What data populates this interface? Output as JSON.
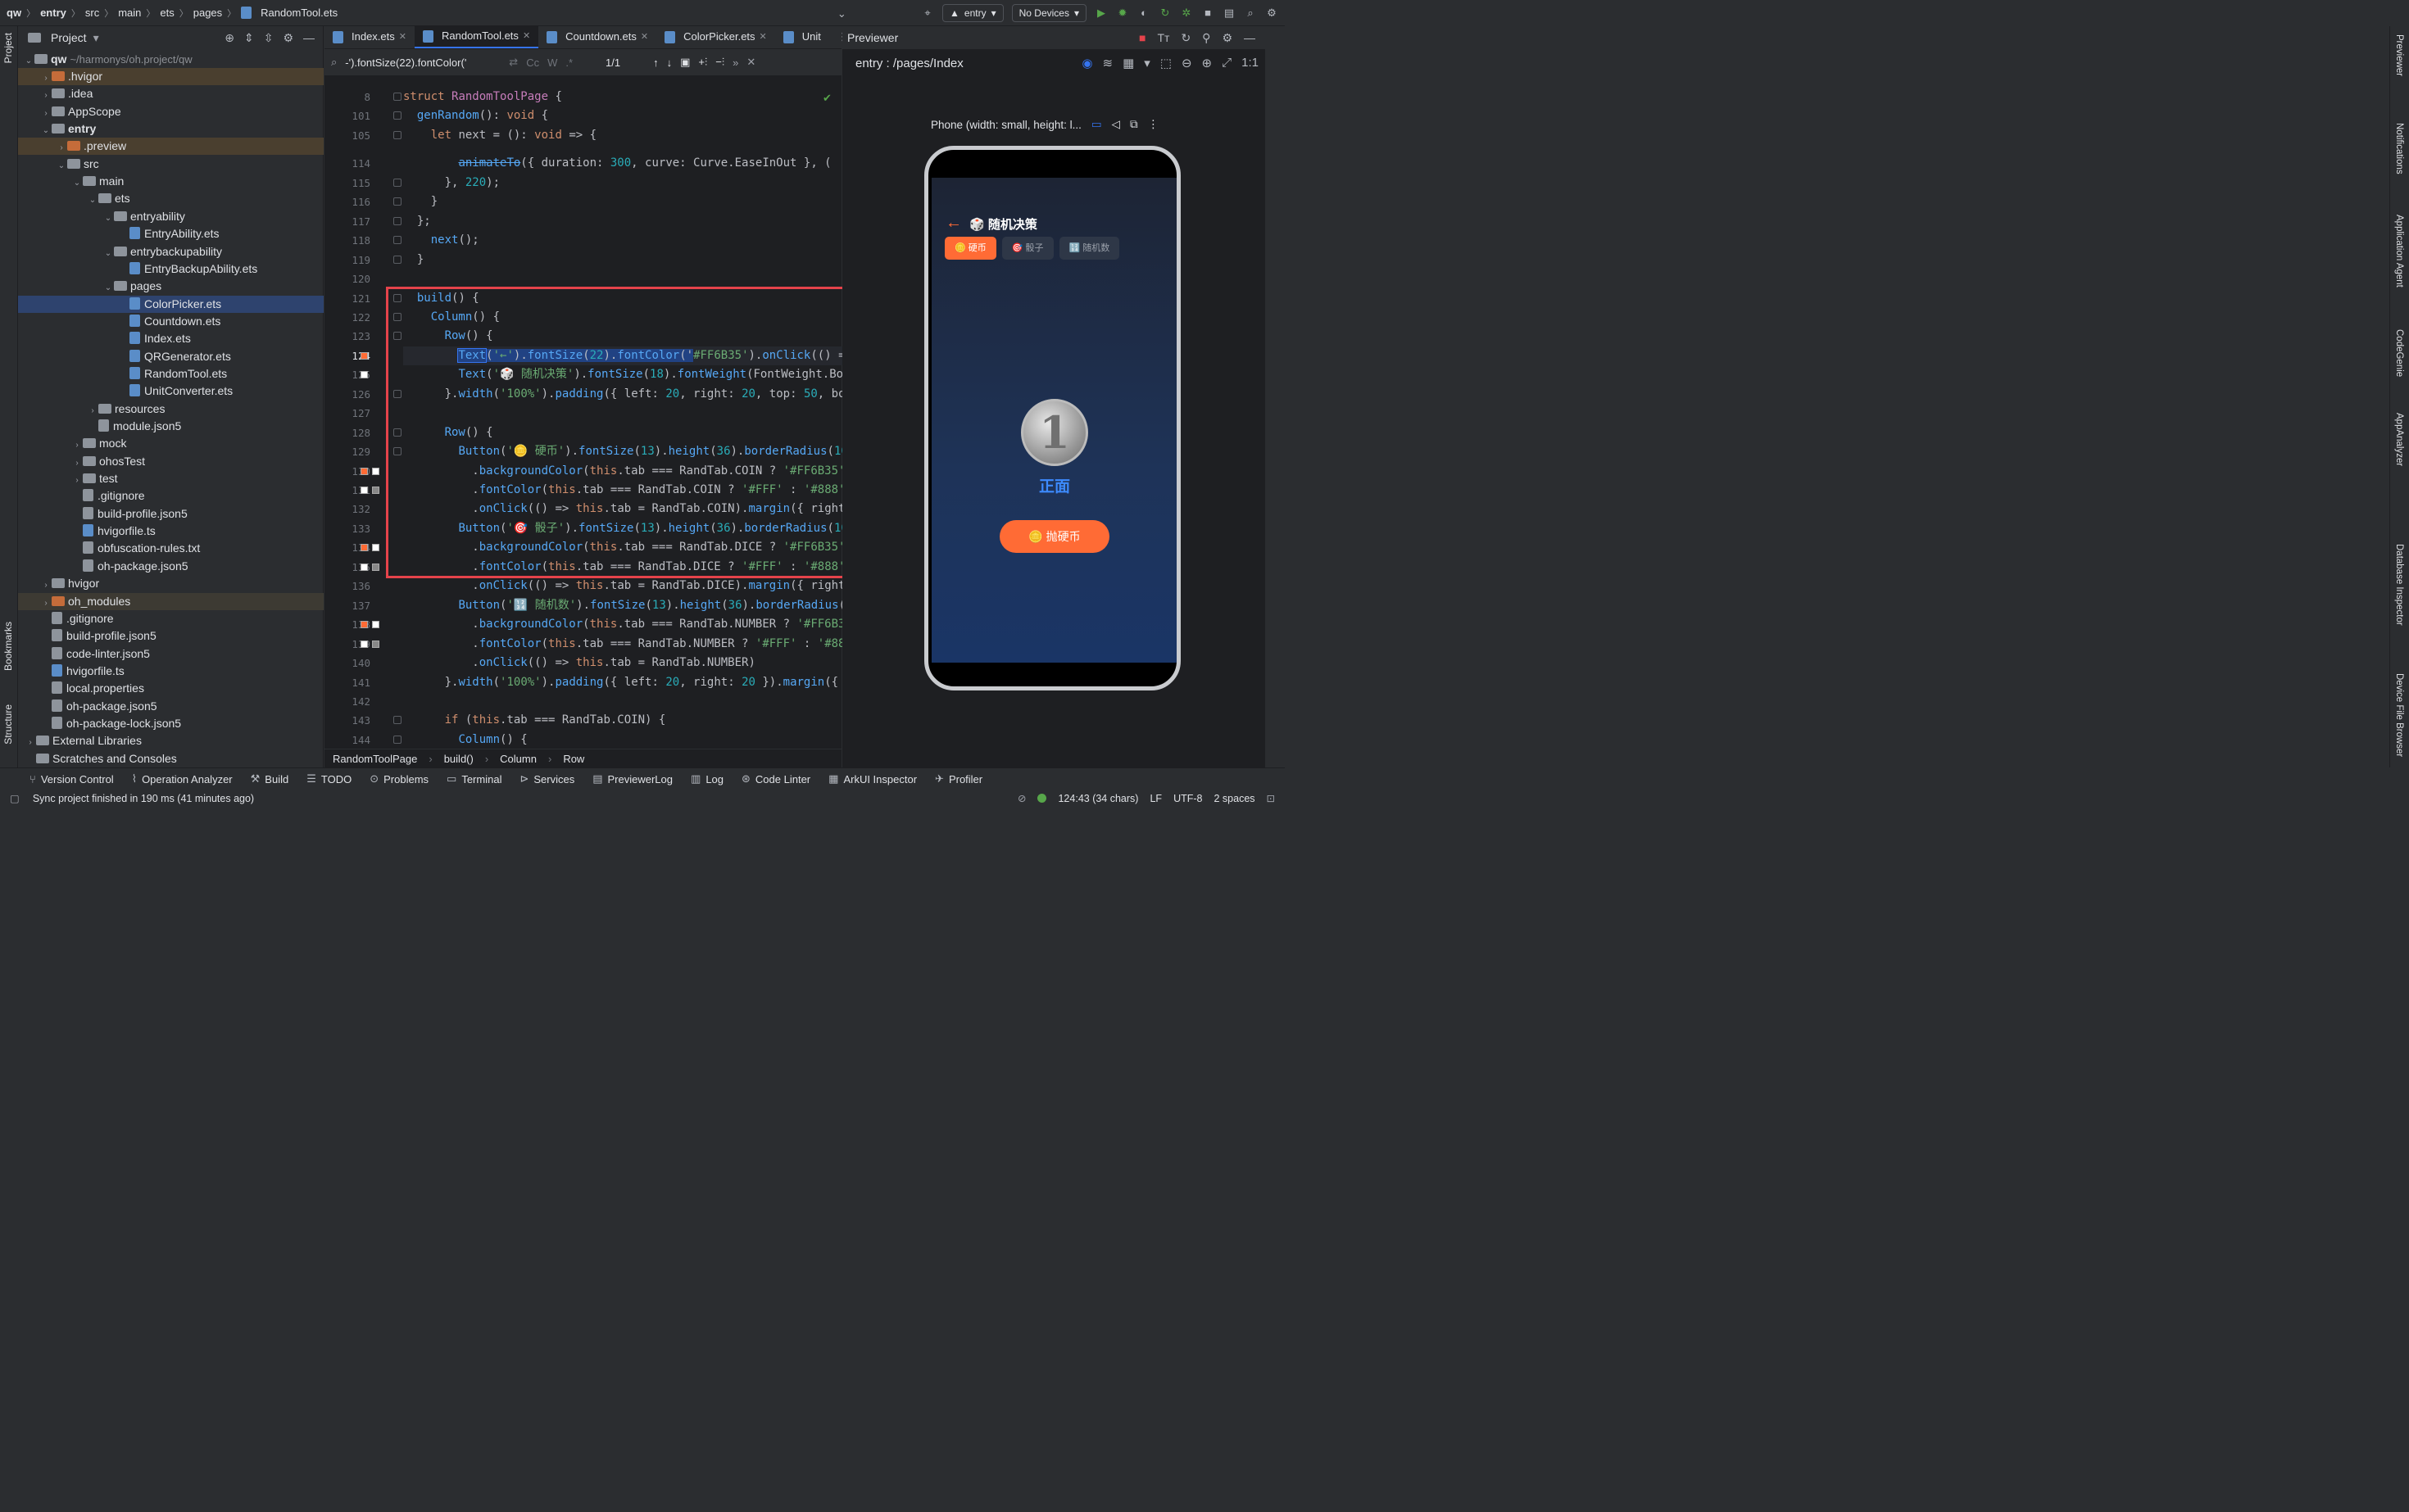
{
  "breadcrumb": [
    "qw",
    "entry",
    "src",
    "main",
    "ets",
    "pages",
    "RandomTool.ets"
  ],
  "toolbar": {
    "run_config": "entry",
    "device": "No Devices"
  },
  "left_strip": {
    "project": "Project",
    "bookmarks": "Bookmarks",
    "structure": "Structure"
  },
  "right_strip": {
    "previewer": "Previewer",
    "notifications": "Notifications",
    "agent": "Application Agent",
    "codegenie": "CodeGenie",
    "appanalyzer": "AppAnalyzer",
    "db": "Database Inspector",
    "dfb": "Device File Browser"
  },
  "project": {
    "title": "Project",
    "root_name": "qw",
    "root_path": "~/harmonys/oh.project/qw",
    "rows": [
      {
        "label": ".hvigor",
        "indent": 1,
        "arrow": "›",
        "icon": "folder-orange",
        "style": "hl"
      },
      {
        "label": ".idea",
        "indent": 1,
        "arrow": "›",
        "icon": "folder"
      },
      {
        "label": "AppScope",
        "indent": 1,
        "arrow": "›",
        "icon": "folder"
      },
      {
        "label": "entry",
        "indent": 1,
        "arrow": "⌄",
        "icon": "folder",
        "bold": true
      },
      {
        "label": ".preview",
        "indent": 2,
        "arrow": "›",
        "icon": "folder-orange",
        "style": "hl"
      },
      {
        "label": "src",
        "indent": 2,
        "arrow": "⌄",
        "icon": "folder"
      },
      {
        "label": "main",
        "indent": 3,
        "arrow": "⌄",
        "icon": "folder"
      },
      {
        "label": "ets",
        "indent": 4,
        "arrow": "⌄",
        "icon": "folder"
      },
      {
        "label": "entryability",
        "indent": 5,
        "arrow": "⌄",
        "icon": "folder"
      },
      {
        "label": "EntryAbility.ets",
        "indent": 6,
        "icon": "file"
      },
      {
        "label": "entrybackupability",
        "indent": 5,
        "arrow": "⌄",
        "icon": "folder"
      },
      {
        "label": "EntryBackupAbility.ets",
        "indent": 6,
        "icon": "file"
      },
      {
        "label": "pages",
        "indent": 5,
        "arrow": "⌄",
        "icon": "folder"
      },
      {
        "label": "ColorPicker.ets",
        "indent": 6,
        "icon": "file",
        "style": "sel"
      },
      {
        "label": "Countdown.ets",
        "indent": 6,
        "icon": "file"
      },
      {
        "label": "Index.ets",
        "indent": 6,
        "icon": "file"
      },
      {
        "label": "QRGenerator.ets",
        "indent": 6,
        "icon": "file"
      },
      {
        "label": "RandomTool.ets",
        "indent": 6,
        "icon": "file"
      },
      {
        "label": "UnitConverter.ets",
        "indent": 6,
        "icon": "file"
      },
      {
        "label": "resources",
        "indent": 4,
        "arrow": "›",
        "icon": "folder"
      },
      {
        "label": "module.json5",
        "indent": 4,
        "icon": "file-gray"
      },
      {
        "label": "mock",
        "indent": 3,
        "arrow": "›",
        "icon": "folder"
      },
      {
        "label": "ohosTest",
        "indent": 3,
        "arrow": "›",
        "icon": "folder"
      },
      {
        "label": "test",
        "indent": 3,
        "arrow": "›",
        "icon": "folder"
      },
      {
        "label": ".gitignore",
        "indent": 3,
        "icon": "file-gray"
      },
      {
        "label": "build-profile.json5",
        "indent": 3,
        "icon": "file-gray"
      },
      {
        "label": "hvigorfile.ts",
        "indent": 3,
        "icon": "file"
      },
      {
        "label": "obfuscation-rules.txt",
        "indent": 3,
        "icon": "file-gray"
      },
      {
        "label": "oh-package.json5",
        "indent": 3,
        "icon": "file-gray"
      },
      {
        "label": "hvigor",
        "indent": 1,
        "arrow": "›",
        "icon": "folder"
      },
      {
        "label": "oh_modules",
        "indent": 1,
        "arrow": "›",
        "icon": "folder-orange",
        "style": "hl2"
      },
      {
        "label": ".gitignore",
        "indent": 1,
        "icon": "file-gray"
      },
      {
        "label": "build-profile.json5",
        "indent": 1,
        "icon": "file-gray"
      },
      {
        "label": "code-linter.json5",
        "indent": 1,
        "icon": "file-gray"
      },
      {
        "label": "hvigorfile.ts",
        "indent": 1,
        "icon": "file"
      },
      {
        "label": "local.properties",
        "indent": 1,
        "icon": "file-gray"
      },
      {
        "label": "oh-package.json5",
        "indent": 1,
        "icon": "file-gray"
      },
      {
        "label": "oh-package-lock.json5",
        "indent": 1,
        "icon": "file-gray"
      },
      {
        "label": "External Libraries",
        "indent": 0,
        "arrow": "›",
        "icon": "lib"
      },
      {
        "label": "Scratches and Consoles",
        "indent": 0,
        "icon": "scratch"
      }
    ]
  },
  "editor": {
    "tabs": [
      "Index.ets",
      "RandomTool.ets",
      "Countdown.ets",
      "ColorPicker.ets",
      "Unit"
    ],
    "active_tab": 1,
    "search_text": "-').fontSize(22).fontColor('",
    "match_count": "1/1",
    "lines": [
      {
        "n": "8",
        "html": "<span class='kw'>struct</span> <span class='ty'>RandomToolPage</span> {"
      },
      {
        "n": "101",
        "html": "  <span class='fn'>genRandom</span>(): <span class='kw'>void</span> {"
      },
      {
        "n": "105",
        "html": "    <span class='kw'>let</span> next = (): <span class='kw'>void</span> => {"
      },
      {
        "n": "114",
        "html": "        <span class='fn' style='text-decoration:line-through'>animateTo</span>({ duration: <span class='num'>300</span>, curve: Curve.EaseInOut }, ("
      },
      {
        "n": "115",
        "html": "      }, <span class='num'>220</span>);"
      },
      {
        "n": "116",
        "html": "    }"
      },
      {
        "n": "117",
        "html": "  };"
      },
      {
        "n": "118",
        "html": "    <span class='fn'>next</span>();"
      },
      {
        "n": "119",
        "html": "  }"
      },
      {
        "n": "120",
        "html": ""
      },
      {
        "n": "121",
        "html": "  <span class='fn'>build</span>() {"
      },
      {
        "n": "122",
        "html": "    <span class='fn'>Column</span>() {"
      },
      {
        "n": "123",
        "html": "      <span class='fn'>Row</span>() {"
      },
      {
        "n": "124",
        "html": "        <span class='fn' style='background:#214283;outline:1px solid #3574f0'>Text</span><span style='background:#214283'>(<span class='str'>'←'</span>).<span class='fn'>fontSize</span>(<span class='num'>22</span>).<span class='fn'>fontColor</span>('</span><span class='str'>#FF6B35'</span>).<span class='fn'>onClick</span>(() ="
      },
      {
        "n": "125",
        "html": "        <span class='fn'>Text</span>(<span class='str'>'🎲 随机决策'</span>).<span class='fn'>fontSize</span>(<span class='num'>18</span>).<span class='fn'>fontWeight</span>(FontWeight.Bo"
      },
      {
        "n": "126",
        "html": "      }.<span class='fn'>width</span>(<span class='str'>'100%'</span>).<span class='fn'>padding</span>({ left: <span class='num'>20</span>, right: <span class='num'>20</span>, top: <span class='num'>50</span>, bo"
      },
      {
        "n": "127",
        "html": ""
      },
      {
        "n": "128",
        "html": "      <span class='fn'>Row</span>() {"
      },
      {
        "n": "129",
        "html": "        <span class='fn'>Button</span>(<span class='str'>'🪙 硬币'</span>).<span class='fn'>fontSize</span>(<span class='num'>13</span>).<span class='fn'>height</span>(<span class='num'>36</span>).<span class='fn'>borderRadius</span>(<span class='num'>10</span>"
      },
      {
        "n": "130",
        "html": "          .<span class='fn'>backgroundColor</span>(<span class='kw'>this</span>.tab === RandTab.COIN ? <span class='str'>'#FF6B35'</span>"
      },
      {
        "n": "131",
        "html": "          .<span class='fn'>fontColor</span>(<span class='kw'>this</span>.tab === RandTab.COIN ? <span class='str'>'#FFF'</span> : <span class='str'>'#888'</span>"
      },
      {
        "n": "132",
        "html": "          .<span class='fn'>onClick</span>(() => <span class='kw'>this</span>.tab = RandTab.COIN).<span class='fn'>margin</span>({ right"
      },
      {
        "n": "133",
        "html": "        <span class='fn'>Button</span>(<span class='str'>'🎯 骰子'</span>).<span class='fn'>fontSize</span>(<span class='num'>13</span>).<span class='fn'>height</span>(<span class='num'>36</span>).<span class='fn'>borderRadius</span>(<span class='num'>10</span>"
      },
      {
        "n": "134",
        "html": "          .<span class='fn'>backgroundColor</span>(<span class='kw'>this</span>.tab === RandTab.DICE ? <span class='str'>'#FF6B35'</span>"
      },
      {
        "n": "135",
        "html": "          .<span class='fn'>fontColor</span>(<span class='kw'>this</span>.tab === RandTab.DICE ? <span class='str'>'#FFF'</span> : <span class='str'>'#888'</span>"
      },
      {
        "n": "136",
        "html": "          .<span class='fn'>onClick</span>(() => <span class='kw'>this</span>.tab = RandTab.DICE).<span class='fn'>margin</span>({ right"
      },
      {
        "n": "137",
        "html": "        <span class='fn'>Button</span>(<span class='str'>'🔢 随机数'</span>).<span class='fn'>fontSize</span>(<span class='num'>13</span>).<span class='fn'>height</span>(<span class='num'>36</span>).<span class='fn'>borderRadius</span>("
      },
      {
        "n": "138",
        "html": "          .<span class='fn'>backgroundColor</span>(<span class='kw'>this</span>.tab === RandTab.NUMBER ? <span class='str'>'#FF6B3</span>"
      },
      {
        "n": "139",
        "html": "          .<span class='fn'>fontColor</span>(<span class='kw'>this</span>.tab === RandTab.NUMBER ? <span class='str'>'#FFF'</span> : <span class='str'>'#88</span>"
      },
      {
        "n": "140",
        "html": "          .<span class='fn'>onClick</span>(() => <span class='kw'>this</span>.tab = RandTab.NUMBER)"
      },
      {
        "n": "141",
        "html": "      }.<span class='fn'>width</span>(<span class='str'>'100%'</span>).<span class='fn'>padding</span>({ left: <span class='num'>20</span>, right: <span class='num'>20</span> }).<span class='fn'>margin</span>({"
      },
      {
        "n": "142",
        "html": ""
      },
      {
        "n": "143",
        "html": "      <span class='kw'>if</span> (<span class='kw'>this</span>.tab === RandTab.COIN) {"
      },
      {
        "n": "144",
        "html": "        <span class='fn'>Column</span>() {"
      }
    ],
    "swatches": [
      {
        "line": "124",
        "colors": [
          "#FF6B35"
        ]
      },
      {
        "line": "125",
        "colors": [
          "#FFFFFF"
        ]
      },
      {
        "line": "130",
        "colors": [
          "#FF6B35",
          "#FFFFFF"
        ]
      },
      {
        "line": "131",
        "colors": [
          "#FFFFFF",
          "#888888"
        ]
      },
      {
        "line": "134",
        "colors": [
          "#FF6B35",
          "#FFFFFF"
        ]
      },
      {
        "line": "135",
        "colors": [
          "#FFFFFF",
          "#888888"
        ]
      },
      {
        "line": "138",
        "colors": [
          "#FF6B35",
          "#FFFFFF"
        ]
      },
      {
        "line": "139",
        "colors": [
          "#FFFFFF",
          "#888888"
        ]
      }
    ],
    "breadcrumb": [
      "RandomToolPage",
      "build()",
      "Column",
      "Row"
    ]
  },
  "previewer": {
    "title": "Previewer",
    "route": "entry : /pages/Index",
    "device_label": "Phone (width: small, height: l...",
    "app": {
      "back": "←",
      "title": "🎲 随机决策",
      "tabs": [
        "🪙 硬币",
        "🎯 骰子",
        "🔢 随机数"
      ],
      "active_tab": 0,
      "coin_number": "1",
      "coin_result": "正面",
      "flip_button": "🪙 抛硬币",
      "accent": "#FF6B35"
    }
  },
  "bottom_tools": [
    "Version Control",
    "Operation Analyzer",
    "Build",
    "TODO",
    "Problems",
    "Terminal",
    "Services",
    "PreviewerLog",
    "Log",
    "Code Linter",
    "ArkUI Inspector",
    "Profiler"
  ],
  "status": {
    "message": "Sync project finished in 190 ms (41 minutes ago)",
    "position": "124:43 (34 chars)",
    "line_sep": "LF",
    "encoding": "UTF-8",
    "indent": "2 spaces"
  }
}
